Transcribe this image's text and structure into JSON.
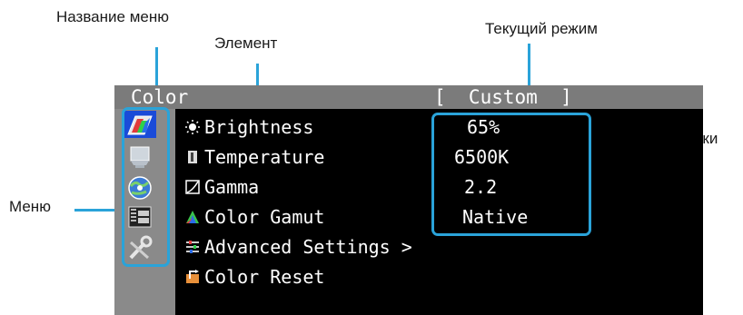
{
  "callouts": {
    "menu_name": "Название меню",
    "item": "Элемент",
    "current_mode": "Текущий режим",
    "settings": "Настройки",
    "menu": "Меню"
  },
  "osd": {
    "title": "Color",
    "mode_display": "[  Custom  ]",
    "menu_icons": [
      "color-menu-icon",
      "monitor-settings-icon",
      "tools-globe-icon",
      "info-abc-icon",
      "wrench-settings-icon"
    ],
    "selected_menu_index": 0,
    "items": [
      {
        "label": "Brightness",
        "icon": "brightness-icon",
        "value": "65%"
      },
      {
        "label": "Temperature",
        "icon": "temperature-icon",
        "value": "6500K"
      },
      {
        "label": "Gamma",
        "icon": "gamma-icon",
        "value": "2.2"
      },
      {
        "label": "Color Gamut",
        "icon": "color-gamut-icon",
        "value": "Native"
      },
      {
        "label": "Advanced Settings >",
        "icon": "advanced-settings-icon",
        "value": ""
      },
      {
        "label": "Color Reset",
        "icon": "color-reset-icon",
        "value": ""
      }
    ]
  },
  "colors": {
    "accent": "#2aa3d9",
    "osd_background": "#000000",
    "titlebar": "#7b7b7b",
    "sidebar": "#8a8a8a",
    "selected_menu": "#1a4bd8"
  }
}
